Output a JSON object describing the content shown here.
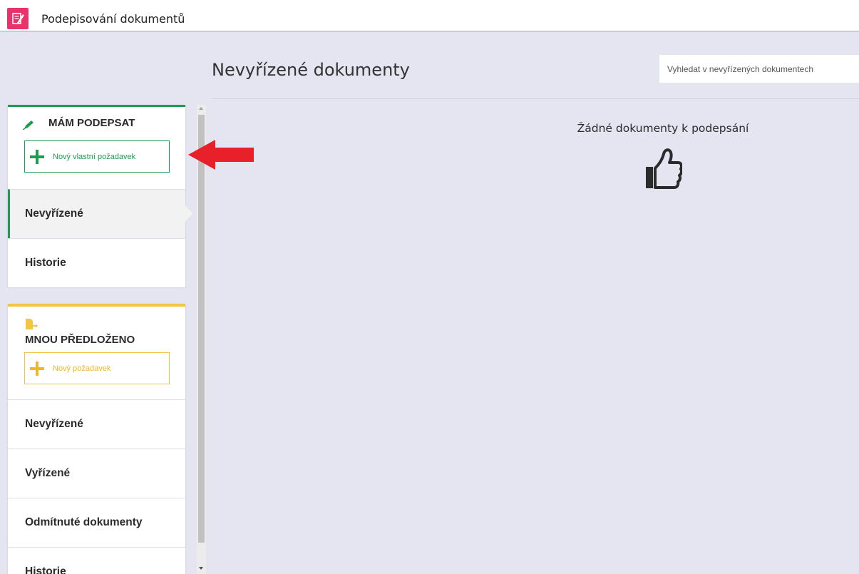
{
  "app": {
    "title": "Podepisování dokumentů",
    "icon": "document-sign-icon",
    "icon_color": "#e8326a"
  },
  "header": {
    "title": "Nevyřízené dokumenty",
    "search_placeholder": "Vyhledat v nevyřízených dokumentech"
  },
  "main": {
    "empty_message": "Žádné dokumenty k podepsání",
    "empty_icon": "thumbs-up-icon"
  },
  "sidebar": {
    "sign_section": {
      "title": "MÁM PODEPSAT",
      "icon": "pen-icon",
      "accent": "#1f9c52",
      "new_button_label": "Nový vlastní požadavek",
      "items": [
        {
          "label": "Nevyřízené",
          "active": true
        },
        {
          "label": "Historie",
          "active": false
        }
      ]
    },
    "submitted_section": {
      "title": "MNOU PŘEDLOŽENO",
      "icon": "document-forward-icon",
      "accent": "#f4c542",
      "new_button_label": "Nový požadavek",
      "items": [
        {
          "label": "Nevyřízené"
        },
        {
          "label": "Vyřízené"
        },
        {
          "label": "Odmítnuté dokumenty"
        },
        {
          "label": "Historie"
        }
      ]
    }
  },
  "annotation": {
    "arrow_color": "#e8202a"
  }
}
